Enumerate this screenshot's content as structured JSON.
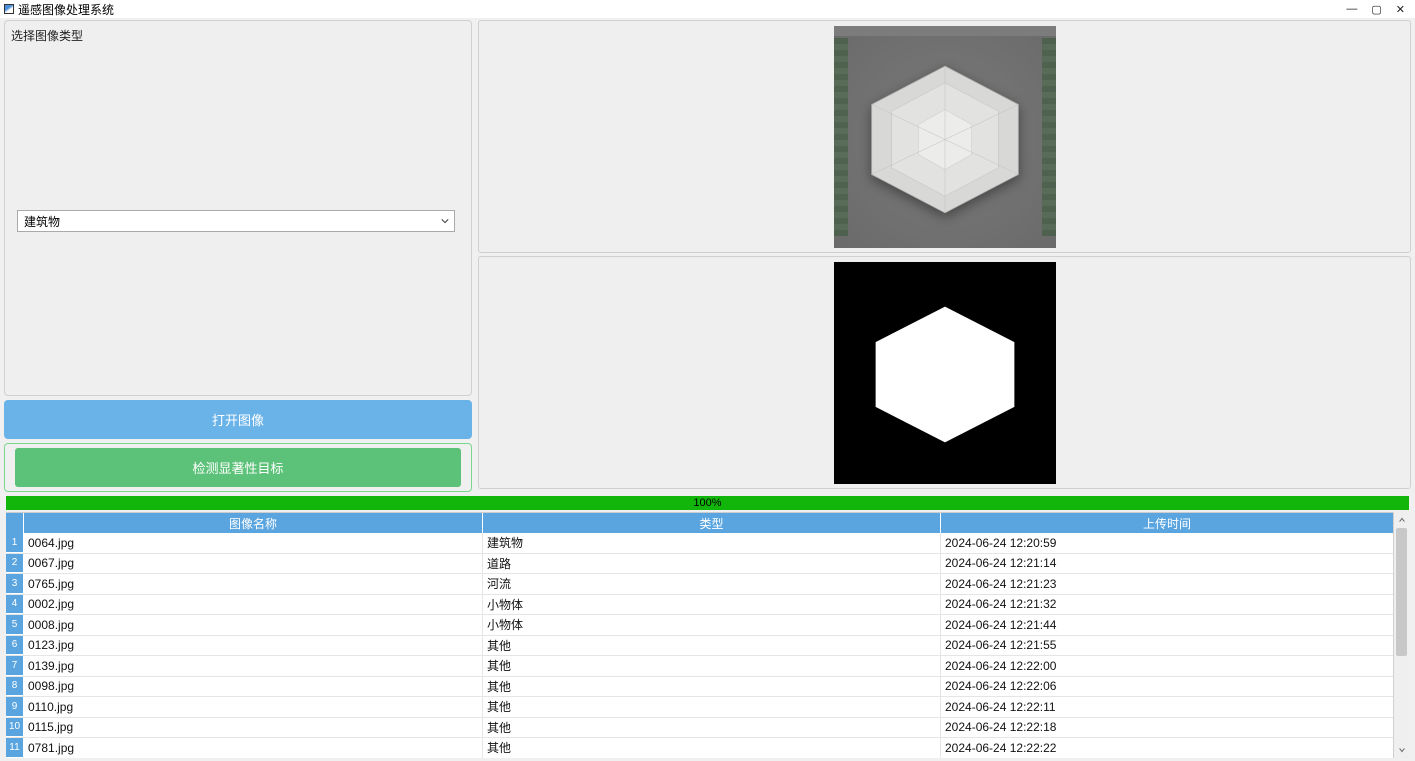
{
  "window": {
    "title": "遥感图像处理系统"
  },
  "left_panel": {
    "select_label": "选择图像类型",
    "dropdown_value": "建筑物",
    "open_button": "打开图像",
    "detect_button": "检测显著性目标"
  },
  "progress": {
    "text": "100%"
  },
  "table": {
    "headers": {
      "name": "图像名称",
      "type": "类型",
      "time": "上传时间"
    },
    "rows": [
      {
        "idx": "1",
        "name": "0064.jpg",
        "type": "建筑物",
        "time": "2024-06-24 12:20:59"
      },
      {
        "idx": "2",
        "name": "0067.jpg",
        "type": "道路",
        "time": "2024-06-24 12:21:14"
      },
      {
        "idx": "3",
        "name": "0765.jpg",
        "type": "河流",
        "time": "2024-06-24 12:21:23"
      },
      {
        "idx": "4",
        "name": "0002.jpg",
        "type": "小物体",
        "time": "2024-06-24 12:21:32"
      },
      {
        "idx": "5",
        "name": "0008.jpg",
        "type": "小物体",
        "time": "2024-06-24 12:21:44"
      },
      {
        "idx": "6",
        "name": "0123.jpg",
        "type": "其他",
        "time": "2024-06-24 12:21:55"
      },
      {
        "idx": "7",
        "name": "0139.jpg",
        "type": "其他",
        "time": "2024-06-24 12:22:00"
      },
      {
        "idx": "8",
        "name": "0098.jpg",
        "type": "其他",
        "time": "2024-06-24 12:22:06"
      },
      {
        "idx": "9",
        "name": "0110.jpg",
        "type": "其他",
        "time": "2024-06-24 12:22:11"
      },
      {
        "idx": "10",
        "name": "0115.jpg",
        "type": "其他",
        "time": "2024-06-24 12:22:18"
      },
      {
        "idx": "11",
        "name": "0781.jpg",
        "type": "其他",
        "time": "2024-06-24 12:22:22"
      }
    ]
  }
}
